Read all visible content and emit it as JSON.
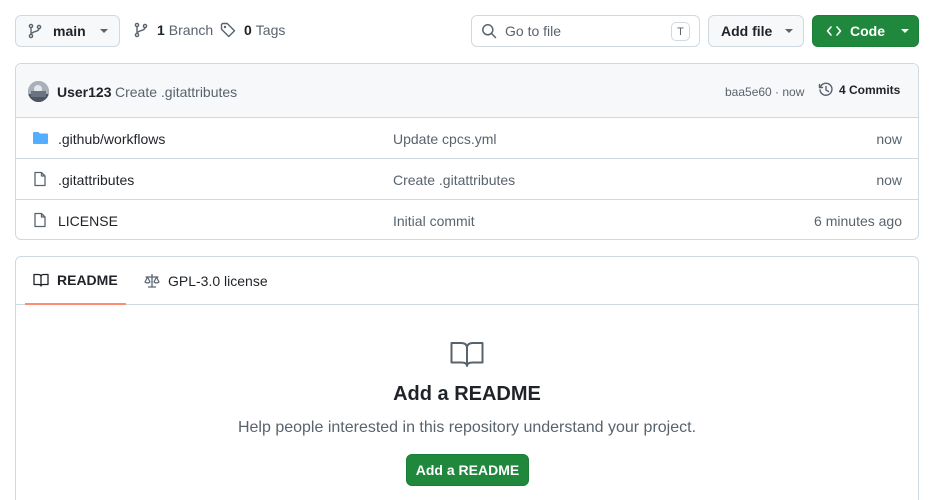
{
  "toolbar": {
    "branch_name": "main",
    "branches_count": "1",
    "branches_label": "Branch",
    "tags_count": "0",
    "tags_label": "Tags",
    "search_placeholder": "Go to file",
    "search_shortcut": "T",
    "add_file_label": "Add file",
    "code_label": "Code"
  },
  "latest_commit": {
    "author": "User123",
    "message": "Create .gitattributes",
    "sha_time": "baa5e60 · now",
    "commits_label": "4 Commits"
  },
  "files": [
    {
      "name": ".github/workflows",
      "type": "folder",
      "commit": "Update cpcs.yml",
      "time": "now"
    },
    {
      "name": ".gitattributes",
      "type": "file",
      "commit": "Create .gitattributes",
      "time": "now"
    },
    {
      "name": "LICENSE",
      "type": "file",
      "commit": "Initial commit",
      "time": "6 minutes ago"
    }
  ],
  "readme": {
    "tab_readme": "README",
    "tab_license": "GPL-3.0 license",
    "title": "Add a README",
    "description": "Help people interested in this repository understand your project.",
    "button_label": "Add a README"
  },
  "colors": {
    "primary_green": "#1f883d",
    "tab_underline": "#fd8c73",
    "folder_blue": "#54aeff",
    "border": "#d1d9e0"
  }
}
